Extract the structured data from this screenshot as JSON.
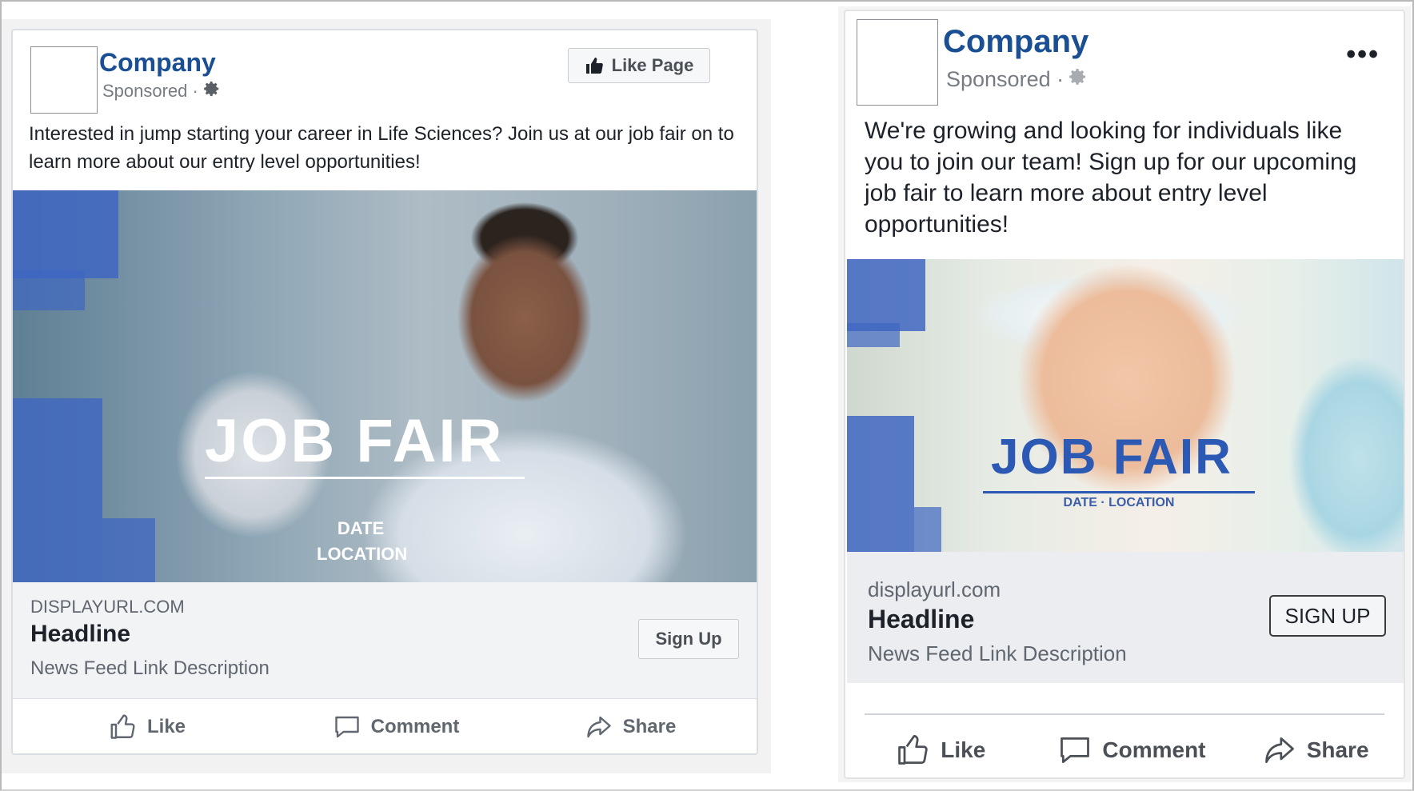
{
  "ads": [
    {
      "company": "Company",
      "sponsored": "Sponsored ·",
      "like_page_label": "Like Page",
      "post_text": "Interested in jump starting your career in Life Sciences? Join us at our job fair on to learn more about our entry level opportunities!",
      "image": {
        "title": "JOB FAIR",
        "line1": "DATE",
        "line2": "LOCATION"
      },
      "link": {
        "display_url": "DISPLAYURL.COM",
        "headline": "Headline",
        "description": "News Feed Link Description",
        "cta": "Sign Up"
      },
      "actions": {
        "like": "Like",
        "comment": "Comment",
        "share": "Share"
      }
    },
    {
      "company": "Company",
      "sponsored": "Sponsored ·",
      "more_label": "•••",
      "post_text": "We're growing and looking for individuals like you to join our team! Sign up for our upcoming job fair to learn more about entry level opportunities!",
      "image": {
        "title": "JOB FAIR",
        "subline": "DATE · LOCATION"
      },
      "link": {
        "display_url": "displayurl.com",
        "headline": "Headline",
        "description": "News Feed Link Description",
        "cta": "SIGN UP"
      },
      "actions": {
        "like": "Like",
        "comment": "Comment",
        "share": "Share"
      }
    }
  ],
  "colors": {
    "brand": "#1b4f93",
    "accent_blue": "#3f66c2",
    "link_bg": "#f2f3f5"
  },
  "icons": [
    "like-page-thumb-icon",
    "gear-icon",
    "more-icon",
    "thumbs-up-icon",
    "comment-icon",
    "share-icon"
  ]
}
